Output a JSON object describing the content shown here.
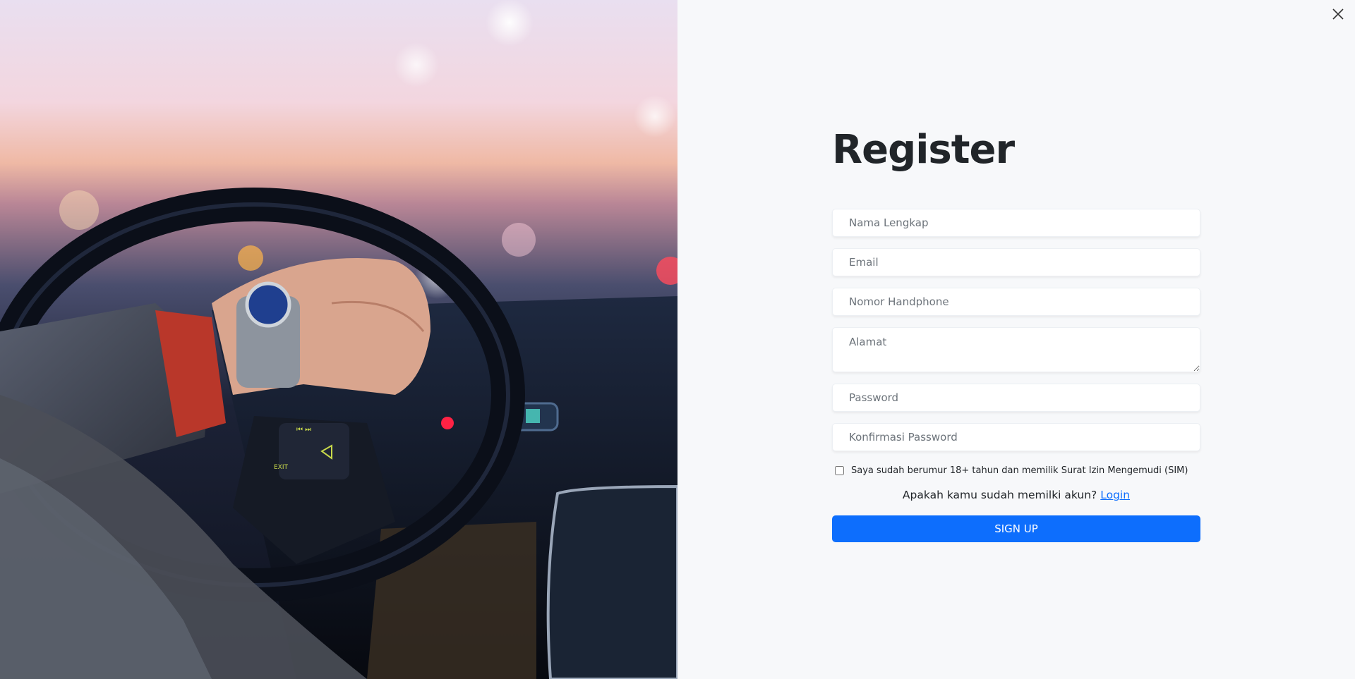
{
  "page": {
    "title": "Register",
    "close_icon": "close-icon",
    "hero_image": "driver-hands-on-steering-wheel-photo"
  },
  "form": {
    "full_name_placeholder": "Nama Lengkap",
    "email_placeholder": "Email",
    "phone_placeholder": "Nomor Handphone",
    "address_placeholder": "Alamat",
    "password_placeholder": "Password",
    "confirm_password_placeholder": "Konfirmasi Password",
    "agreement_label": "Saya sudah berumur 18+ tahun dan memilik Surat Izin Mengemudi (SIM)",
    "agreement_checked": false,
    "login_prompt": "Apakah kamu sudah memilki akun?",
    "login_link": "Login",
    "submit_label": "SIGN UP"
  },
  "colors": {
    "primary": "#0d6efd",
    "background": "#f7f8fa",
    "text": "#212529"
  }
}
